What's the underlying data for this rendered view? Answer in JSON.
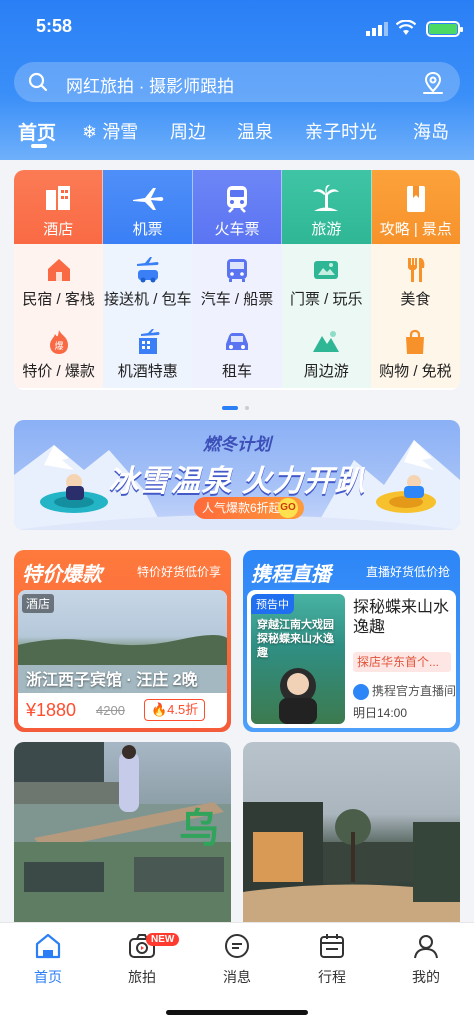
{
  "status": {
    "time": "5:58"
  },
  "search": {
    "placeholder": "网红旅拍 · 摄影师跟拍"
  },
  "tabs": [
    "首页",
    "❄ 滑雪",
    "周边",
    "温泉",
    "亲子时光",
    "海岛"
  ],
  "grid": {
    "main": [
      "酒店",
      "机票",
      "火车票",
      "旅游",
      "攻略 | 景点"
    ],
    "row2": [
      "民宿 / 客栈",
      "接送机 / 包车",
      "汽车 / 船票",
      "门票 / 玩乐",
      "美食"
    ],
    "row3": [
      "特价 / 爆款",
      "机酒特惠",
      "租车",
      "周边游",
      "购物 / 免税"
    ]
  },
  "banner": {
    "sup": "燃冬计划",
    "title": "冰雪温泉  火力开趴",
    "pill": "人气爆款6折起",
    "go": "GO"
  },
  "promo_left": {
    "title": "特价爆款",
    "subtitle": "特价好货低价享",
    "tag": "酒店",
    "name": "浙江西子宾馆 · 汪庄 2晚",
    "price": "¥1880",
    "old_price": "4200",
    "discount": "🔥4.5折"
  },
  "promo_right": {
    "title": "携程直播",
    "subtitle": "直播好货低价抢",
    "poster_tag": "预告中",
    "poster_text": "穿越江南大戏园 探秘蝶来山水逸趣",
    "headline": "探秘蝶来山水逸趣",
    "tag": "探店华东首个...",
    "channel": "携程官方直播间",
    "time": "明日14:00"
  },
  "tabbar": [
    "首页",
    "旅拍",
    "消息",
    "行程",
    "我的"
  ],
  "badge_new": "NEW",
  "colors": {
    "primary": "#2a7ff6",
    "accent": "#ff4d2e"
  }
}
